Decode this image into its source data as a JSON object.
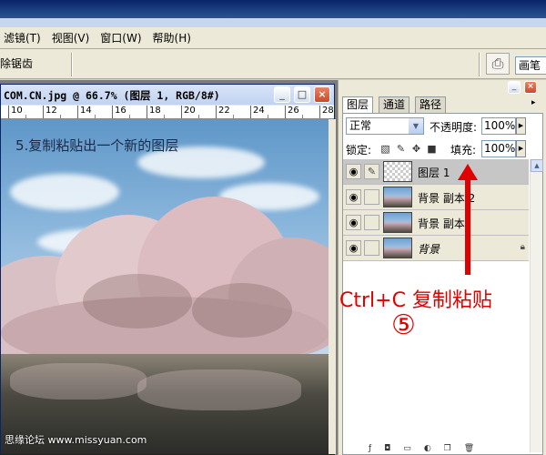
{
  "menu": {
    "items": [
      "滤镜(T)",
      "视图(V)",
      "窗口(W)",
      "帮助(H)"
    ]
  },
  "options": {
    "antialias_label": "除锯齿",
    "brush_label": "画笔"
  },
  "document": {
    "title": "COM.CN.jpg @ 66.7% (图层 1, RGB/8#)",
    "ruler_numbers": [
      "10",
      "12",
      "14",
      "16",
      "18",
      "20",
      "22",
      "24",
      "26",
      "28"
    ],
    "step_text": "5.复制粘贴出一个新的图层",
    "watermark": "思缘论坛 www.missyuan.com"
  },
  "layers_panel": {
    "tabs": [
      "图层",
      "通道",
      "路径"
    ],
    "blend_mode": "正常",
    "opacity_label": "不透明度:",
    "opacity_value": "100%",
    "lock_label": "锁定:",
    "fill_label": "填充:",
    "fill_value": "100%",
    "layers": [
      {
        "name": "图层 1",
        "selected": true,
        "thumb": "transparent"
      },
      {
        "name": "背景 副本 2",
        "selected": false,
        "thumb": "photo"
      },
      {
        "name": "背景 副本",
        "selected": false,
        "thumb": "photo"
      },
      {
        "name": "背景",
        "selected": false,
        "thumb": "photo",
        "locked": true
      }
    ]
  },
  "annotation": {
    "text": "Ctrl+C 复制粘贴",
    "circled_number": "⑤",
    "color": "#e00000"
  }
}
